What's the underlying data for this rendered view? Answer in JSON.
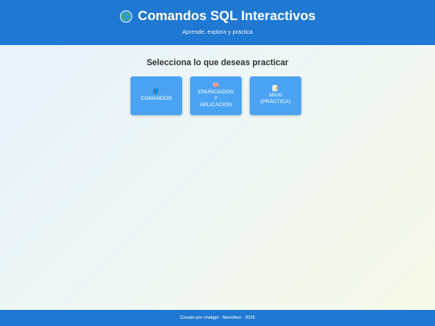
{
  "header": {
    "title": "Comandos SQL Interactivos",
    "title_icon": "globe-icon",
    "subtitle": "Aprende, explora y practica"
  },
  "main": {
    "prompt": "Selecciona lo que deseas practicar",
    "buttons": [
      {
        "icon": "📘",
        "icon_name": "book-icon",
        "lines": [
          "COMANDOS"
        ]
      },
      {
        "icon": "🧠",
        "icon_name": "brain-icon",
        "lines": [
          "ENUNCIADOS",
          "Y",
          "APLICACIÓN"
        ]
      },
      {
        "icon": "📝",
        "icon_name": "memo-icon",
        "lines": [
          "MAXI",
          "(PRÁCTICA)"
        ]
      }
    ]
  },
  "footer": {
    "text": "Creado por chatgpt · Neocities · 2025"
  },
  "colors": {
    "header_bg": "#1f78d1",
    "button_bg": "#4aa3f2",
    "footer_bg": "#1f78d1"
  }
}
